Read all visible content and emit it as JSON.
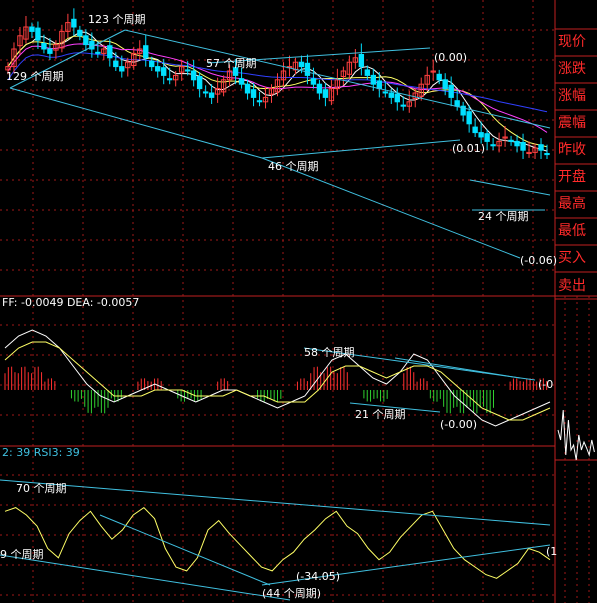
{
  "sidebar": {
    "labels": [
      "现价",
      "涨跌",
      "涨幅",
      "震幅",
      "昨收",
      "开盘",
      "最高",
      "最低",
      "买入",
      "卖出"
    ],
    "color": "#ff2a2a"
  },
  "colors": {
    "background": "#000000",
    "border": "#c02020",
    "grid": "#a01818",
    "up": "#ff4040",
    "down": "#00e0ff",
    "ma5": "#ffffff",
    "ma10": "#ffff66",
    "ma20": "#ff40ff",
    "ma60": "#3040ff",
    "trendline": "#40c0e0",
    "dif": "#ffffff",
    "dea": "#ffff66",
    "macd_pos": "#ff3030",
    "macd_neg": "#30d030",
    "rsi": "#ffff66",
    "label_text": "#ffffff",
    "macd_header": "#ffffff",
    "rsi_header": "#40c0e0"
  },
  "macd_header": "FF: -0.0049 DEA: -0.0057",
  "rsi_header": "2: 39 RSI3: 39",
  "price_annotations": [
    "123 个周期",
    "129 个周期",
    "57 个周期",
    "(0.00)",
    "46 个周期",
    "(0.01)",
    "24 个周期",
    "(-0.06)"
  ],
  "macd_annotations": [
    "58 个周期",
    "21 个周期",
    "(-0.00)",
    "(-0"
  ],
  "rsi_annotations": [
    "70 个周期",
    "9 个周期",
    "(-34.05)",
    "(44 个周期)",
    "(1"
  ],
  "chart_data": [
    {
      "type": "candlestick",
      "panel": "price",
      "title": "",
      "grid": true,
      "legend": "none",
      "ylim": [
        0,
        100
      ],
      "note": "normalized index trace of a downtrending price with moving averages; values relative, no axis printed",
      "close_trace": [
        72,
        80,
        86,
        90,
        88,
        84,
        80,
        78,
        82,
        88,
        92,
        90,
        86,
        82,
        80,
        78,
        80,
        76,
        72,
        70,
        74,
        78,
        80,
        76,
        72,
        70,
        68,
        66,
        68,
        72,
        70,
        66,
        62,
        60,
        58,
        62,
        66,
        70,
        68,
        64,
        60,
        58,
        56,
        58,
        62,
        66,
        70,
        72,
        74,
        72,
        68,
        64,
        60,
        58,
        62,
        66,
        70,
        74,
        76,
        72,
        68,
        64,
        62,
        60,
        58,
        56,
        54,
        56,
        60,
        64,
        68,
        70,
        66,
        62,
        58,
        54,
        50,
        46,
        42,
        40,
        38,
        36,
        38,
        40,
        38,
        36,
        34,
        33,
        35,
        34,
        32
      ],
      "moving_averages": [
        "MA5",
        "MA10",
        "MA20",
        "MA60"
      ]
    },
    {
      "type": "bar",
      "panel": "macd",
      "title": "",
      "grid": true,
      "legend": "none",
      "series": [
        {
          "name": "DIF",
          "values": [
            0.7,
            0.9,
            1.0,
            0.9,
            0.7,
            0.4,
            0.1,
            -0.1,
            -0.2,
            -0.1,
            0.0,
            0.1,
            0.0,
            -0.1,
            -0.2,
            -0.1,
            0.0,
            0.0,
            -0.1,
            -0.2,
            -0.3,
            -0.2,
            -0.1,
            0.2,
            0.5,
            0.6,
            0.4,
            0.2,
            0.1,
            0.3,
            0.6,
            0.5,
            0.2,
            -0.1,
            -0.3,
            -0.5,
            -0.6,
            -0.5,
            -0.4,
            -0.3,
            -0.2
          ]
        },
        {
          "name": "DEA",
          "values": [
            0.5,
            0.7,
            0.8,
            0.8,
            0.7,
            0.5,
            0.3,
            0.1,
            -0.1,
            -0.1,
            -0.1,
            0.0,
            0.0,
            0.0,
            -0.1,
            -0.1,
            -0.1,
            0.0,
            -0.1,
            -0.1,
            -0.2,
            -0.2,
            -0.2,
            0.0,
            0.3,
            0.4,
            0.4,
            0.3,
            0.2,
            0.3,
            0.4,
            0.4,
            0.3,
            0.1,
            -0.1,
            -0.3,
            -0.4,
            -0.5,
            -0.5,
            -0.4,
            -0.3
          ]
        }
      ],
      "histogram": [
        0.4,
        0.4,
        0.4,
        0.2,
        0.0,
        -0.2,
        -0.4,
        -0.4,
        -0.2,
        0.0,
        0.2,
        0.2,
        0.0,
        -0.2,
        -0.2,
        0.0,
        0.2,
        0.0,
        0.0,
        -0.2,
        -0.2,
        0.0,
        0.2,
        0.4,
        0.4,
        0.4,
        0.0,
        -0.2,
        -0.2,
        0.0,
        0.4,
        0.2,
        -0.2,
        -0.4,
        -0.4,
        -0.4,
        -0.4,
        0.0,
        0.2,
        0.2,
        0.2
      ]
    },
    {
      "type": "line",
      "panel": "rsi",
      "title": "",
      "grid": true,
      "legend": "none",
      "ylim": [
        0,
        100
      ],
      "series": [
        {
          "name": "RSI",
          "values": [
            60,
            62,
            58,
            52,
            40,
            35,
            48,
            55,
            60,
            52,
            45,
            50,
            58,
            62,
            56,
            40,
            30,
            28,
            35,
            50,
            55,
            48,
            42,
            36,
            30,
            28,
            34,
            38,
            45,
            50,
            56,
            60,
            52,
            48,
            40,
            34,
            38,
            46,
            52,
            58,
            60,
            50,
            40,
            34,
            30,
            26,
            24,
            28,
            32,
            40,
            38,
            34
          ]
        }
      ]
    }
  ]
}
